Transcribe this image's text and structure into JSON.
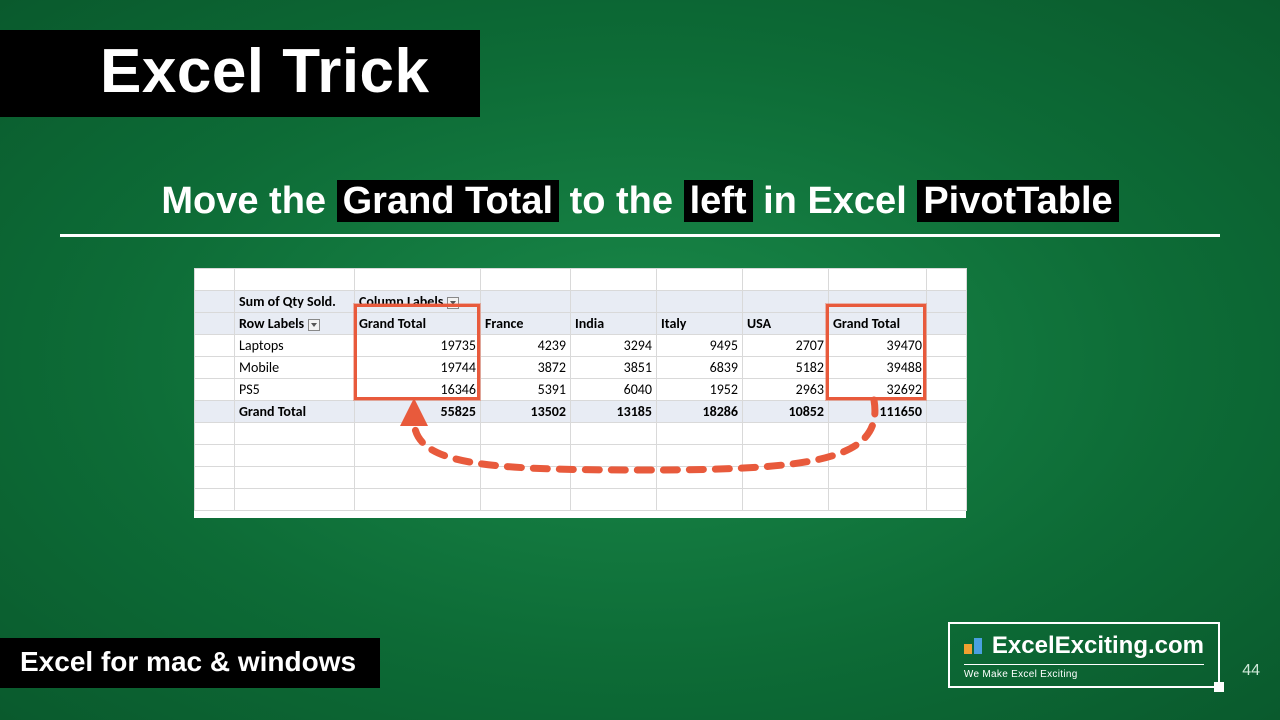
{
  "title": "Excel Trick",
  "subtitle": {
    "t1": "Move the ",
    "h1": "Grand Total",
    "t2": " to the ",
    "h2": "left",
    "t3": " in Excel ",
    "h3": "PivotTable"
  },
  "pivot": {
    "sum_label": "Sum of Qty Sold.",
    "col_labels": "Column Labels",
    "row_labels": "Row Labels",
    "cols": [
      "Grand Total",
      "France",
      "India",
      "Italy",
      "USA",
      "Grand Total"
    ],
    "rows": [
      {
        "name": "Laptops",
        "vals": [
          "19735",
          "4239",
          "3294",
          "9495",
          "2707",
          "39470"
        ]
      },
      {
        "name": "Mobile",
        "vals": [
          "19744",
          "3872",
          "3851",
          "6839",
          "5182",
          "39488"
        ]
      },
      {
        "name": "PS5",
        "vals": [
          "16346",
          "5391",
          "6040",
          "1952",
          "2963",
          "32692"
        ]
      }
    ],
    "gt_row": {
      "name": "Grand Total",
      "vals": [
        "55825",
        "13502",
        "13185",
        "18286",
        "10852",
        "111650"
      ]
    }
  },
  "footer": "Excel for mac & windows",
  "brand": {
    "name": "ExcelExciting.com",
    "tag": "We Make Excel Exciting"
  },
  "page": "44"
}
